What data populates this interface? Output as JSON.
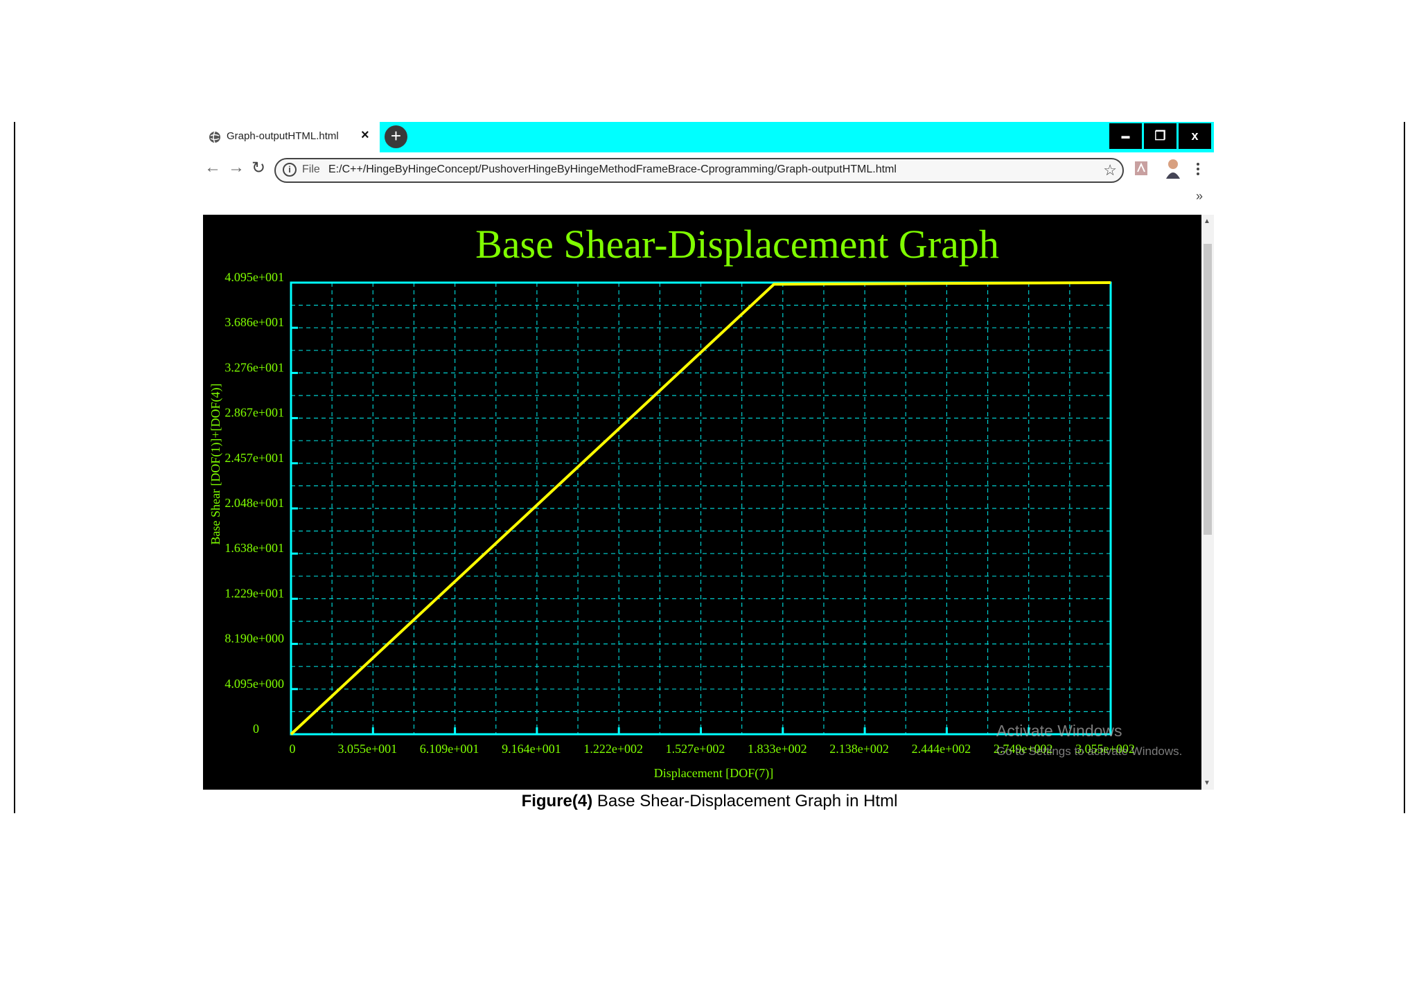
{
  "browser": {
    "tab_title": "Graph-outputHTML.html",
    "tab_close": "×",
    "new_tab": "+",
    "window_controls": {
      "minimize": "▬",
      "restore": "❐",
      "close": "x"
    },
    "address": {
      "scheme": "File",
      "url": "E:/C++/HingeByHingeConcept/PushoverHingeByHingeMethodFrameBrace-Cprogramming/Graph-outputHTML.html"
    },
    "bookmarks_chevron": "»",
    "icons": [
      "globe-icon",
      "back-icon",
      "forward-icon",
      "reload-icon",
      "info-icon",
      "star-icon",
      "pdf-icon",
      "profile-icon",
      "menu-icon"
    ]
  },
  "overlay": {
    "activate_title": "Activate Windows",
    "activate_sub": "Go to Settings to activate Windows."
  },
  "caption": {
    "bold": "Figure(4)",
    "text": " Base Shear-Displacement Graph in Html"
  },
  "colors": {
    "background": "#000000",
    "grid": "#00d0d0",
    "axis": "#00ffff",
    "text": "#80ff00",
    "line": "#ffff00",
    "tabbar": "#00ffff"
  },
  "chart_data": {
    "type": "line",
    "title": "Base Shear-Displacement Graph",
    "xlabel": "Displacement [DOF(7)]",
    "ylabel": "Base Shear [DOF(1)]+[DOF(4)]",
    "xlim": [
      0,
      305.5
    ],
    "ylim": [
      0,
      40.95
    ],
    "x_ticks": [
      "0",
      "3.055e+001",
      "6.109e+001",
      "9.164e+001",
      "1.222e+002",
      "1.527e+002",
      "1.833e+002",
      "2.138e+002",
      "2.444e+002",
      "2.749e+002",
      "3.055e+002"
    ],
    "y_ticks": [
      "0",
      "4.095e+000",
      "8.190e+000",
      "1.229e+001",
      "1.638e+001",
      "2.048e+001",
      "2.457e+001",
      "2.867e+001",
      "3.276e+001",
      "3.686e+001",
      "4.095e+001"
    ],
    "grid": true,
    "series": [
      {
        "x": [
          0,
          180,
          305.5
        ],
        "y": [
          0,
          40.8,
          40.95
        ]
      }
    ]
  }
}
